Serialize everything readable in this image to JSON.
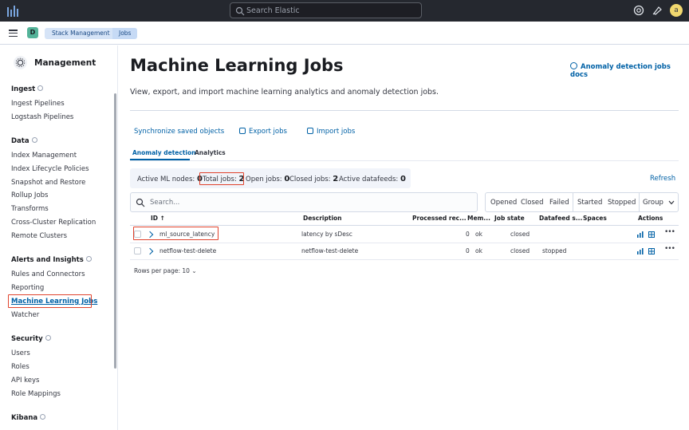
{
  "topbar": {
    "search_placeholder": "Search Elastic",
    "avatar_letter": "a"
  },
  "breadcrumbs": {
    "space": "D",
    "items": [
      "Stack Management",
      "Jobs"
    ]
  },
  "sidebar": {
    "title": "Management",
    "sections": [
      {
        "title": "Ingest",
        "items": [
          "Ingest Pipelines",
          "Logstash Pipelines"
        ]
      },
      {
        "title": "Data",
        "items": [
          "Index Management",
          "Index Lifecycle Policies",
          "Snapshot and Restore",
          "Rollup Jobs",
          "Transforms",
          "Cross-Cluster Replication",
          "Remote Clusters"
        ]
      },
      {
        "title": "Alerts and Insights",
        "items": [
          "Rules and Connectors",
          "Reporting",
          "Machine Learning Jobs",
          "Watcher"
        ]
      },
      {
        "title": "Security",
        "items": [
          "Users",
          "Roles",
          "API keys",
          "Role Mappings"
        ]
      },
      {
        "title": "Kibana",
        "items": []
      }
    ]
  },
  "main": {
    "title": "Machine Learning Jobs",
    "docs_link": "Anomaly detection jobs docs",
    "description": "View, export, and import machine learning analytics and anomaly detection jobs.",
    "actions": [
      "Synchronize saved objects",
      "Export jobs",
      "Import jobs"
    ],
    "tabs": [
      "Anomaly detection",
      "Analytics"
    ],
    "stats": [
      {
        "label": "Active ML nodes:",
        "value": "0"
      },
      {
        "label": "Total jobs:",
        "value": "2"
      },
      {
        "label": "Open jobs:",
        "value": "0"
      },
      {
        "label": "Closed jobs:",
        "value": "2"
      },
      {
        "label": "Active datafeeds:",
        "value": "0"
      }
    ],
    "refresh": "Refresh",
    "filter_placeholder": "Search...",
    "filter_buttons": [
      "Opened",
      "Closed",
      "Failed",
      "Started",
      "Stopped",
      "Group"
    ],
    "columns": [
      "ID",
      "Description",
      "Processed rec...",
      "Mem...",
      "Job state",
      "Datafeed s...",
      "Spaces",
      "Actions"
    ],
    "rows": [
      {
        "id": "ml_source_latency",
        "description": "latency by sDesc",
        "processed": "0",
        "memory": "ok",
        "job_state": "closed",
        "datafeed": ""
      },
      {
        "id": "netflow-test-delete",
        "description": "netflow-test-delete",
        "processed": "0",
        "memory": "ok",
        "job_state": "closed",
        "datafeed": "stopped"
      }
    ],
    "rows_per_page": "Rows per page: 10"
  }
}
